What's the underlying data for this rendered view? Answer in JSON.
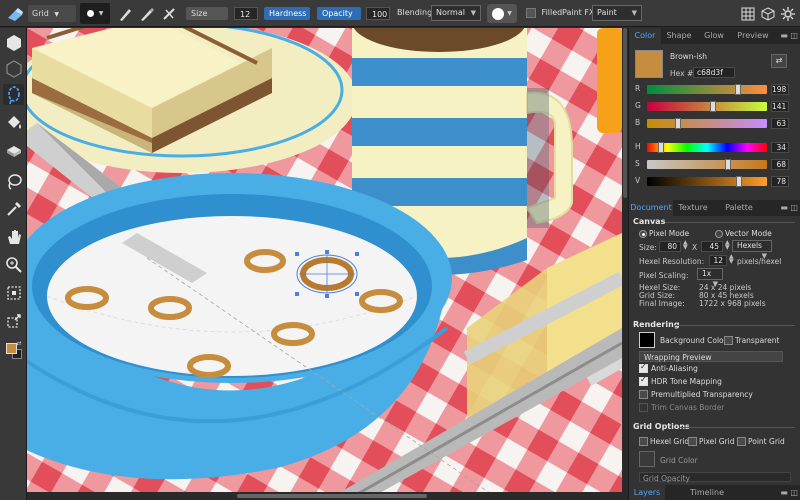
{
  "toolbar": {
    "brush_mode": "Grid",
    "size_label": "Size",
    "size_value": "12",
    "hardness_label": "Hardness",
    "opacity_label": "Opacity",
    "opacity_value": "100",
    "blending_label": "Blending:",
    "blending_value": "Normal",
    "filled_label": "Filled",
    "paint_fx_label": "Paint FX:",
    "paint_fx_value": "Paint"
  },
  "tools": [
    "hexagon-fill-tool",
    "hexagon-outline-tool",
    "lasso-tool",
    "paint-bucket-tool",
    "eraser-tool",
    "freehand-lasso-tool",
    "eyedropper-tool",
    "hand-tool",
    "zoom-tool",
    "crop-tool",
    "transform-tool"
  ],
  "color_panel": {
    "tabs": [
      "Color",
      "Shape",
      "Glow",
      "Preview"
    ],
    "active_tab": "Color",
    "color_name": "Brown-ish",
    "hex_label": "Hex #:",
    "hex_value": "c68d3f",
    "swatch_color": "#c68d3f",
    "rgb": [
      {
        "label": "R",
        "value": "198",
        "fraction": 0.776
      },
      {
        "label": "G",
        "value": "141",
        "fraction": 0.553
      },
      {
        "label": "B",
        "value": "63",
        "fraction": 0.247
      }
    ],
    "hsv": [
      {
        "label": "H",
        "value": "34",
        "fraction": 0.094
      },
      {
        "label": "S",
        "value": "68",
        "fraction": 0.68
      },
      {
        "label": "V",
        "value": "78",
        "fraction": 0.78
      }
    ]
  },
  "document_panel": {
    "tabs": [
      "Document",
      "Texture",
      "Palette"
    ],
    "active_tab": "Document",
    "canvas_heading": "Canvas",
    "pixel_mode": "Pixel Mode",
    "vector_mode": "Vector Mode",
    "size_label": "Size:",
    "width": "80",
    "x_label": "X",
    "height": "45",
    "unit": "Hexels",
    "hexel_resolution_label": "Hexel Resolution:",
    "hexel_resolution": "12",
    "hexel_resolution_unit": "pixels/hexel",
    "pixel_scaling_label": "Pixel Scaling:",
    "pixel_scaling": "1x",
    "hexel_size_label": "Hexel Size:",
    "hexel_size": "24 x 24 pixels",
    "grid_size_label": "Grid Size:",
    "grid_size": "80 x 45 hexels",
    "final_image_label": "Final Image:",
    "final_image": "1722 x 968 pixels",
    "rendering_heading": "Rendering",
    "background_color_label": "Background Color",
    "transparent_label": "Transparent",
    "wrapping_preview": "Wrapping Preview",
    "anti_aliasing": "Anti-Aliasing",
    "hdr_tone_mapping": "HDR Tone Mapping",
    "premultiplied_transparency": "Premultiplied Transparency",
    "trim_canvas_border": "Trim Canvas Border",
    "grid_options_heading": "Grid Options",
    "hexel_grid": "Hexel Grid",
    "pixel_grid": "Pixel Grid",
    "point_grid": "Point Grid",
    "grid_color_label": "Grid Color",
    "grid_opacity_label": "Grid Opacity"
  },
  "bottom_tabs": [
    "Layers",
    "Timeline"
  ],
  "colors": {
    "accent": "#4ea6ff",
    "tablecloth_red": "#e8636b",
    "bowl_blue": "#4aaee6",
    "cereal": "#c68d3f"
  }
}
